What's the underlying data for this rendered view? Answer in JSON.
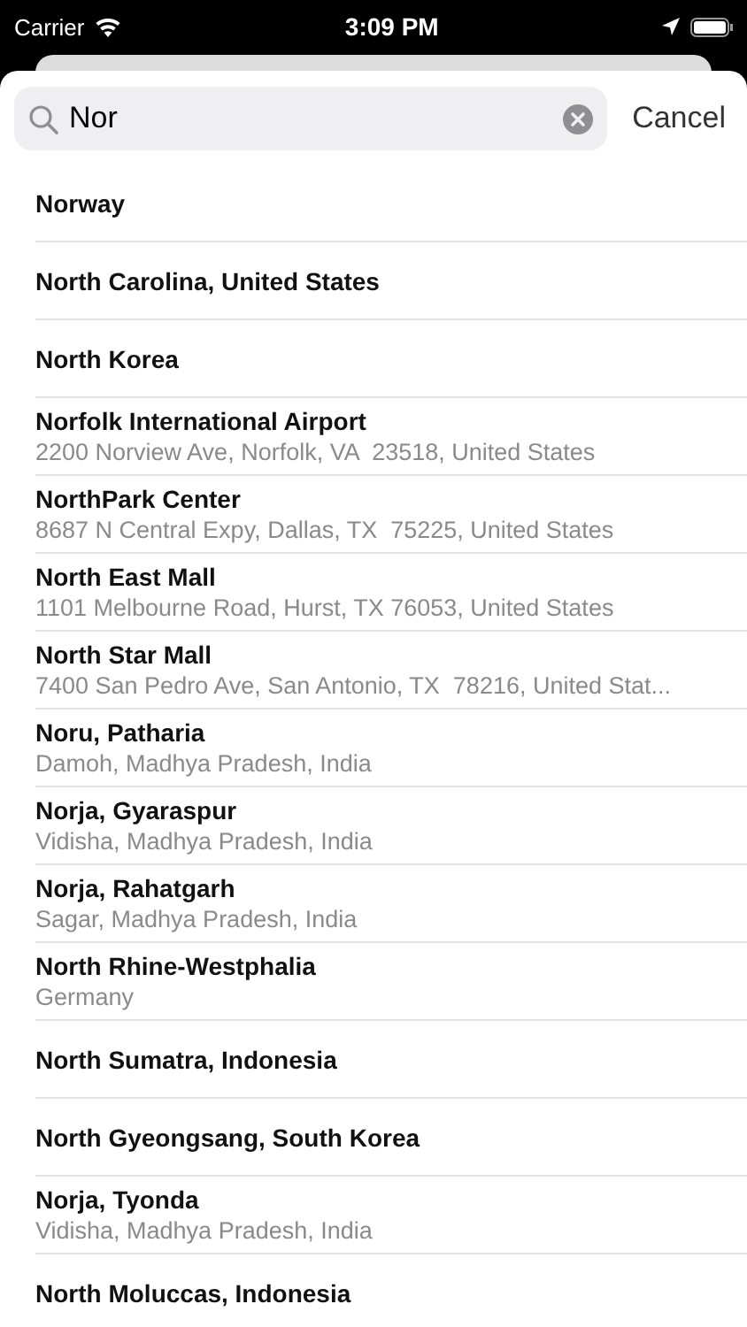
{
  "status_bar": {
    "carrier": "Carrier",
    "time": "3:09 PM"
  },
  "search": {
    "value": "Nor",
    "cancel": "Cancel"
  },
  "results": [
    {
      "title": "Norway"
    },
    {
      "title": "North Carolina, United States"
    },
    {
      "title": "North Korea"
    },
    {
      "title": "Norfolk International Airport",
      "subtitle": "2200 Norview Ave, Norfolk, VA  23518, United States"
    },
    {
      "title": "NorthPark Center",
      "subtitle": "8687 N Central Expy, Dallas, TX  75225, United States"
    },
    {
      "title": "North East Mall",
      "subtitle": "1101 Melbourne Road, Hurst, TX 76053, United States"
    },
    {
      "title": "North Star Mall",
      "subtitle": "7400 San Pedro Ave, San Antonio, TX  78216, United Stat..."
    },
    {
      "title": "Noru, Patharia",
      "subtitle": "Damoh, Madhya Pradesh, India"
    },
    {
      "title": "Norja, Gyaraspur",
      "subtitle": "Vidisha, Madhya Pradesh, India"
    },
    {
      "title": "Norja, Rahatgarh",
      "subtitle": "Sagar, Madhya Pradesh, India"
    },
    {
      "title": "North Rhine-Westphalia",
      "subtitle": "Germany"
    },
    {
      "title": "North Sumatra, Indonesia"
    },
    {
      "title": "North Gyeongsang, South Korea"
    },
    {
      "title": "Norja, Tyonda",
      "subtitle": "Vidisha, Madhya Pradesh, India"
    },
    {
      "title": "North Moluccas, Indonesia"
    }
  ]
}
